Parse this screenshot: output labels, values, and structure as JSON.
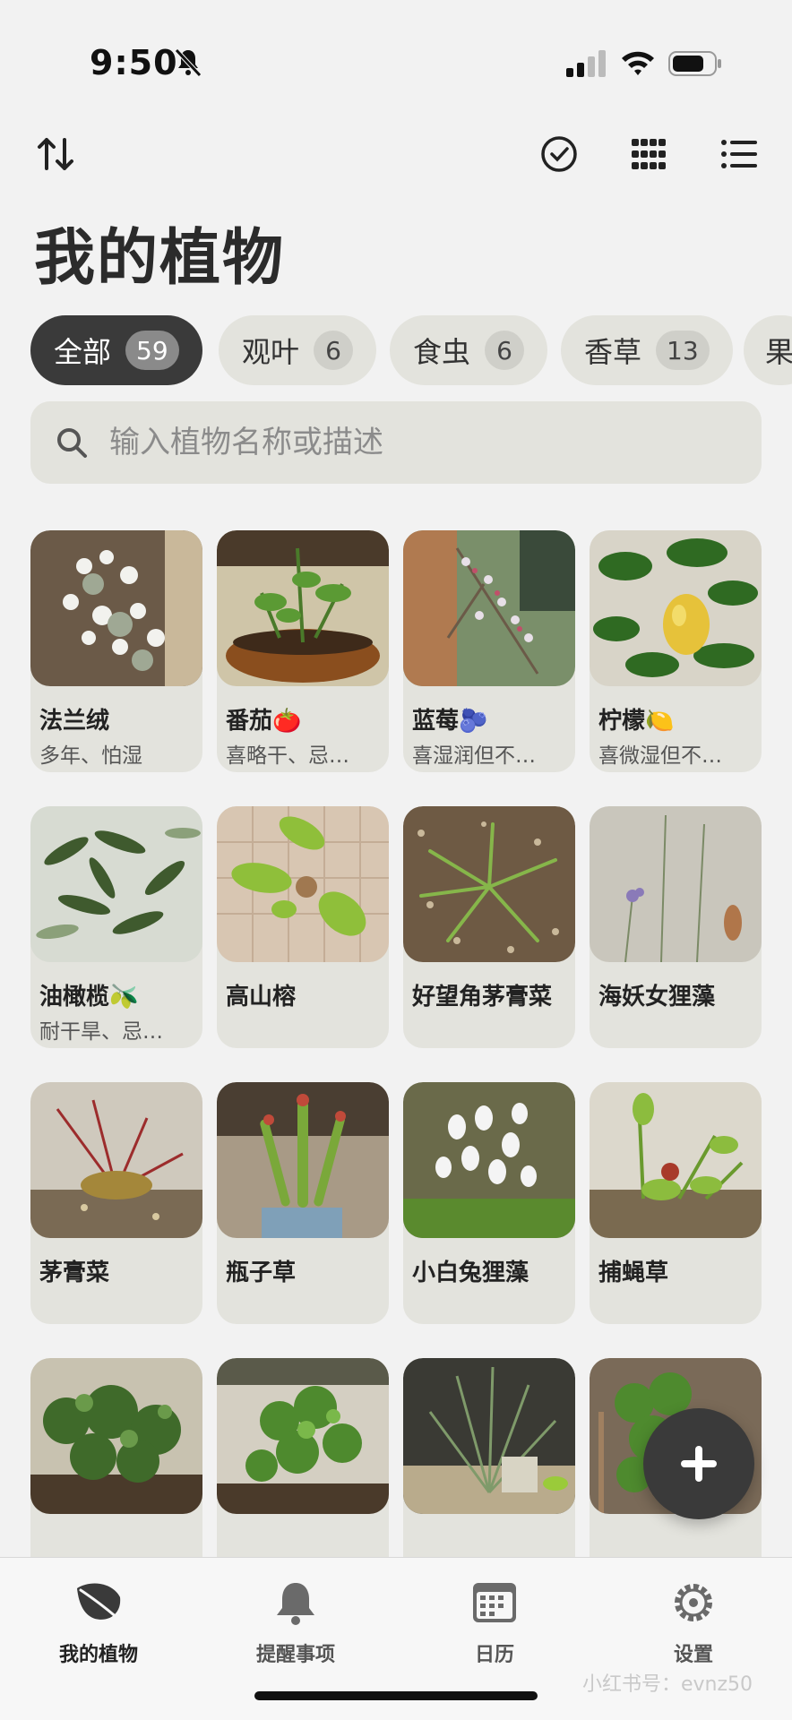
{
  "status_bar": {
    "time": "9:50"
  },
  "toolbar": {
    "sort_icon": "sort-arrows-icon",
    "select_icon": "check-circle-icon",
    "grid_icon": "grid-view-icon",
    "list_icon": "list-view-icon"
  },
  "title": "我的植物",
  "filters": [
    {
      "label": "全部",
      "count": "59",
      "active": true
    },
    {
      "label": "观叶",
      "count": "6"
    },
    {
      "label": "食虫",
      "count": "6"
    },
    {
      "label": "香草",
      "count": "13"
    },
    {
      "label": "果"
    }
  ],
  "search": {
    "placeholder": "输入植物名称或描述",
    "value": ""
  },
  "plants": [
    {
      "name": "法兰绒",
      "desc": "多年、怕湿"
    },
    {
      "name": "番茄🍅",
      "desc": "喜略干、忌…"
    },
    {
      "name": "蓝莓🫐",
      "desc": "喜湿润但不…"
    },
    {
      "name": "柠檬🍋",
      "desc": "喜微湿但不…"
    },
    {
      "name": "油橄榄🫒",
      "desc": "耐干旱、忌…"
    },
    {
      "name": "高山榕",
      "desc": ""
    },
    {
      "name": "好望角茅膏菜",
      "desc": ""
    },
    {
      "name": "海妖女狸藻",
      "desc": ""
    },
    {
      "name": "茅膏菜",
      "desc": ""
    },
    {
      "name": "瓶子草",
      "desc": ""
    },
    {
      "name": "小白兔狸藻",
      "desc": ""
    },
    {
      "name": "捕蝇草",
      "desc": ""
    },
    {
      "name": "",
      "desc": ""
    },
    {
      "name": "",
      "desc": ""
    },
    {
      "name": "",
      "desc": ""
    },
    {
      "name": "",
      "desc": ""
    }
  ],
  "fab": {
    "icon": "plus-icon"
  },
  "tabs": [
    {
      "label": "我的植物",
      "icon": "leaf-icon",
      "active": true
    },
    {
      "label": "提醒事项",
      "icon": "bell-icon"
    },
    {
      "label": "日历",
      "icon": "calendar-icon"
    },
    {
      "label": "设置",
      "icon": "gear-icon"
    }
  ],
  "watermark": "小红书号：evnz50",
  "colors": {
    "accent": "#3a3a3a",
    "chip_bg": "#e3e3dd",
    "background": "#f2f2f2"
  }
}
